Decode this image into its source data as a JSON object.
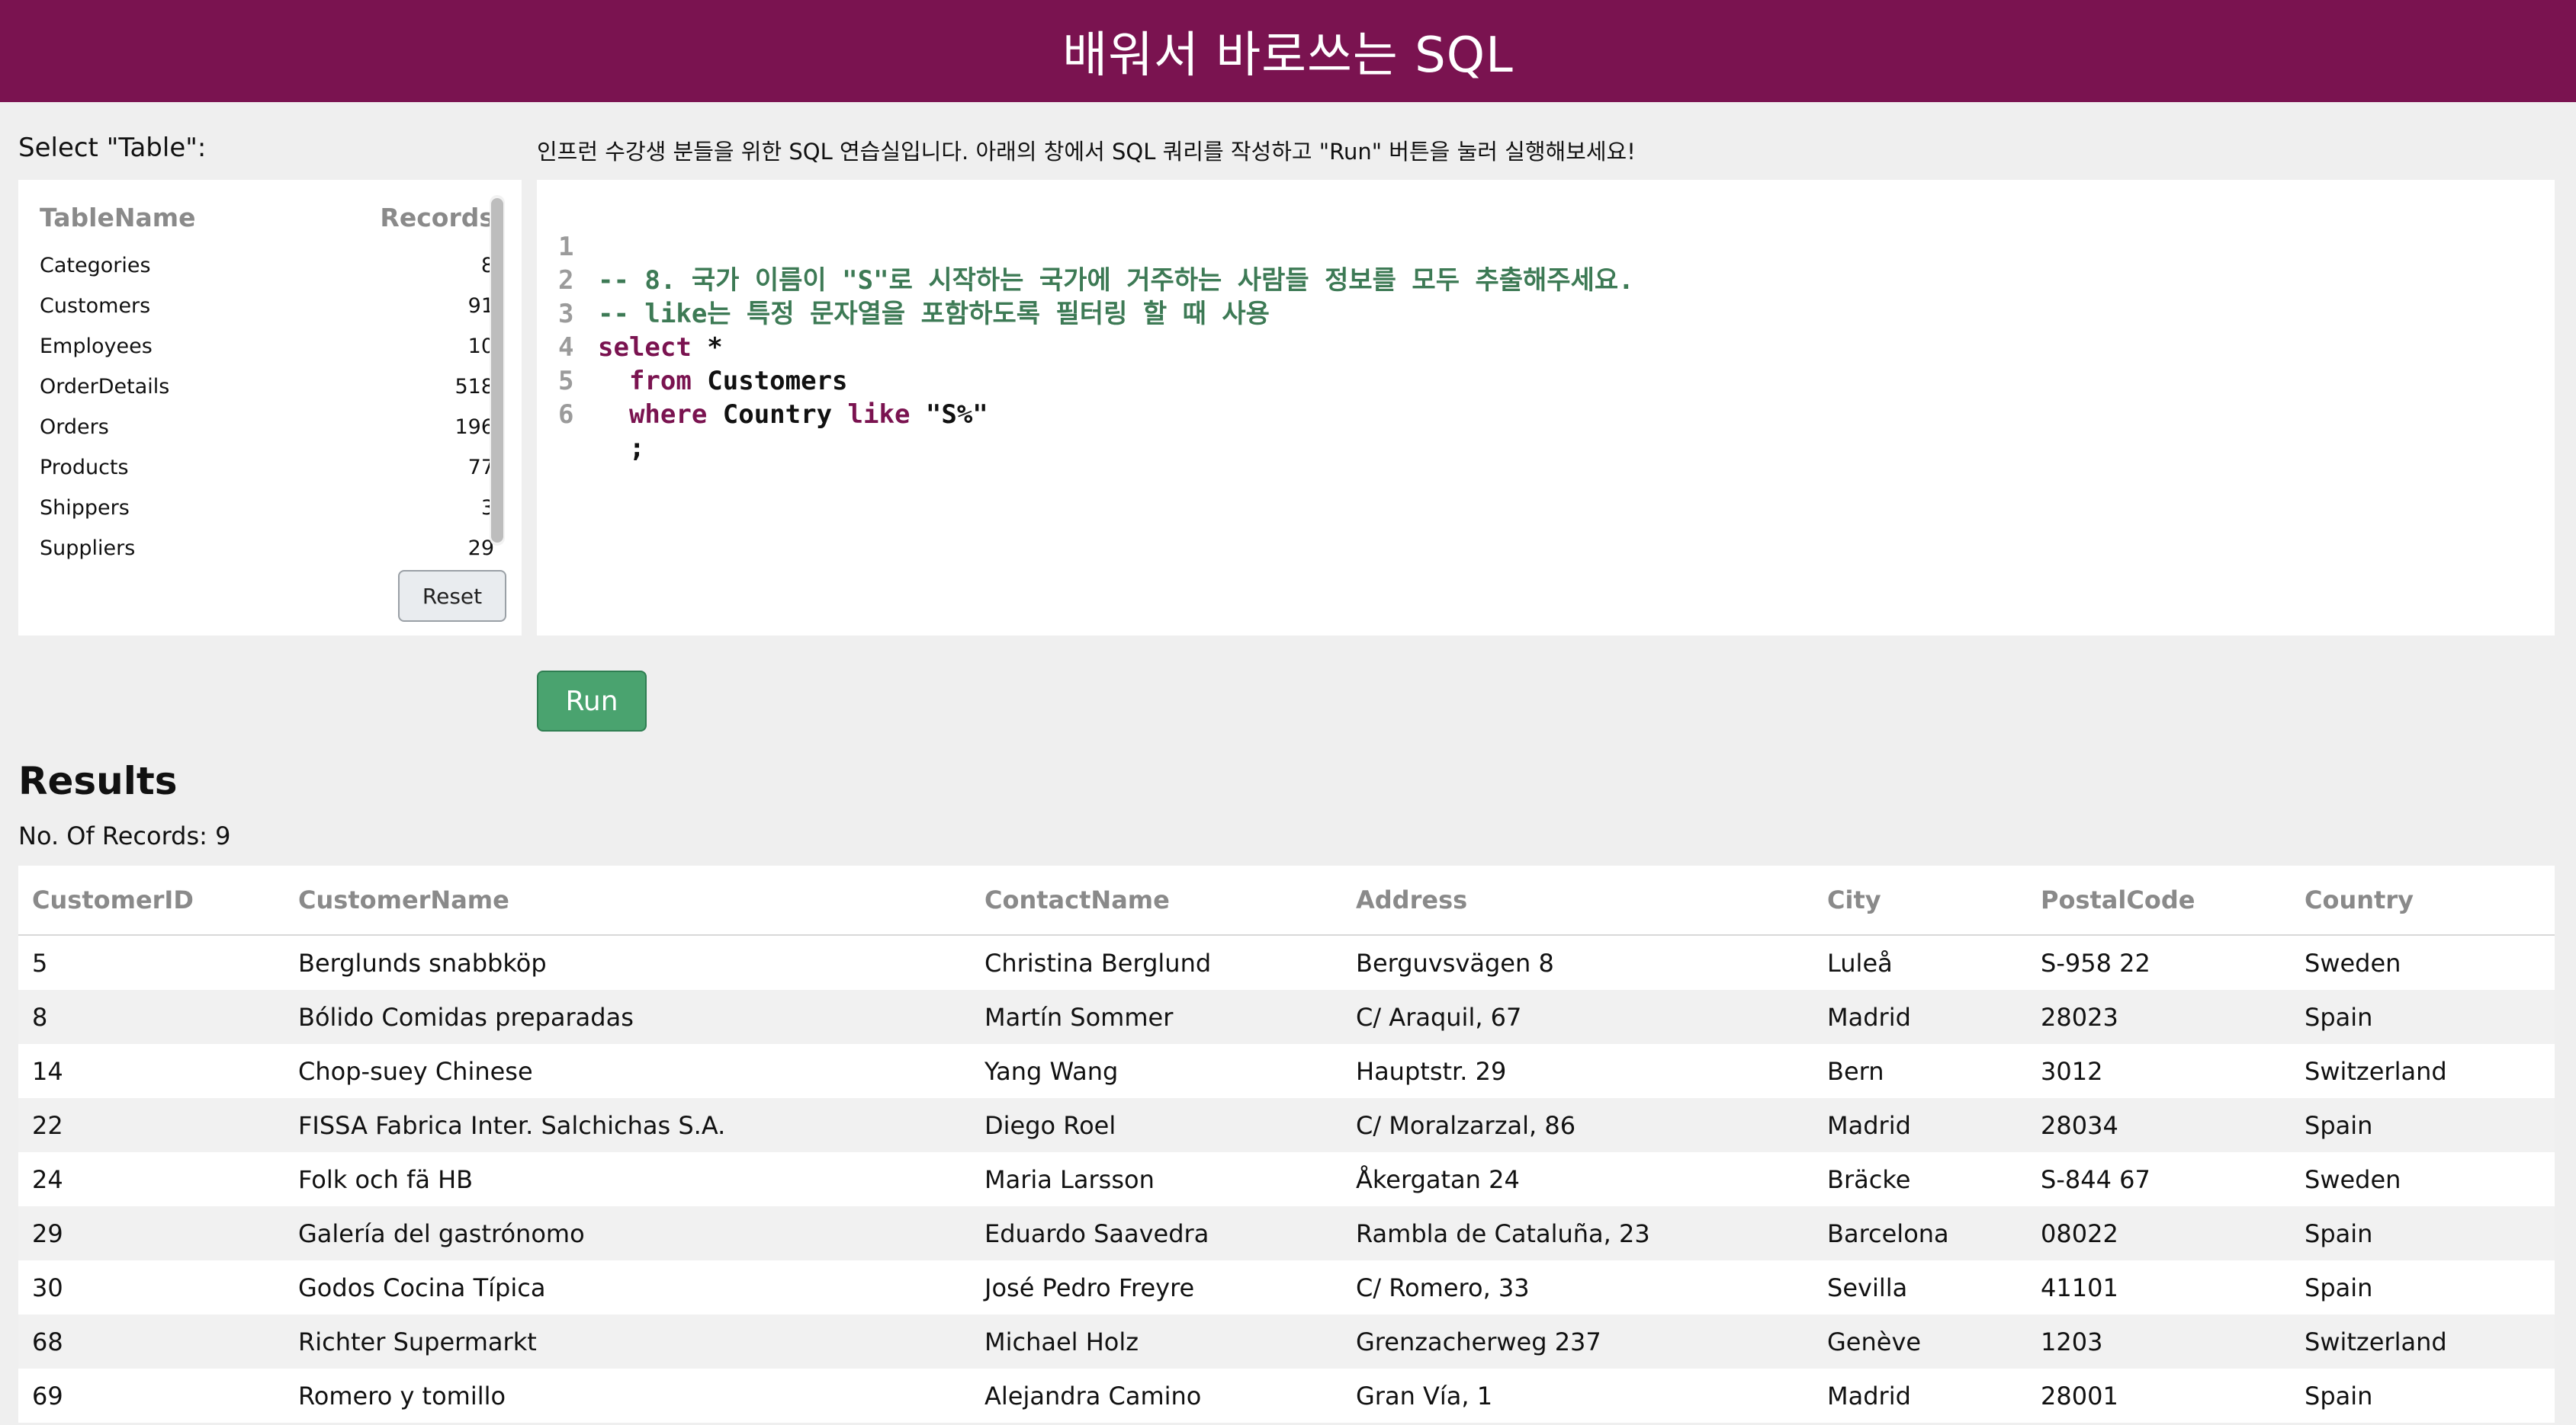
{
  "header": {
    "title": "배워서 바로쓰는 SQL"
  },
  "left": {
    "select_label": "Select \"Table\":",
    "col_name": "TableName",
    "col_records": "Records",
    "tables": [
      {
        "name": "Categories",
        "records": "8"
      },
      {
        "name": "Customers",
        "records": "91"
      },
      {
        "name": "Employees",
        "records": "10"
      },
      {
        "name": "OrderDetails",
        "records": "518"
      },
      {
        "name": "Orders",
        "records": "196"
      },
      {
        "name": "Products",
        "records": "77"
      },
      {
        "name": "Shippers",
        "records": "3"
      },
      {
        "name": "Suppliers",
        "records": "29"
      }
    ],
    "reset_label": "Reset"
  },
  "intro": "인프런 수강생 분들을 위한 SQL 연습실입니다. 아래의 창에서 SQL 쿼리를 작성하고 \"Run\" 버튼을 눌러 실행해보세요!",
  "editor": {
    "lines": [
      {
        "num": "1",
        "parts": [
          {
            "t": "-- 8. 국가 이름이 \"S\"로 시작하는 국가에 거주하는 사람들 정보를 모두 추출해주세요.",
            "c": "cm"
          }
        ]
      },
      {
        "num": "2",
        "parts": [
          {
            "t": "-- like는 특정 문자열을 포함하도록 필터링 할 때 사용",
            "c": "cm"
          }
        ]
      },
      {
        "num": "3",
        "parts": [
          {
            "t": "select",
            "c": "kw"
          },
          {
            "t": " *",
            "c": "id"
          }
        ]
      },
      {
        "num": "4",
        "parts": [
          {
            "t": "  from",
            "c": "kw"
          },
          {
            "t": " Customers",
            "c": "id"
          }
        ]
      },
      {
        "num": "5",
        "parts": [
          {
            "t": "  where",
            "c": "kw"
          },
          {
            "t": " Country ",
            "c": "id"
          },
          {
            "t": "like",
            "c": "kw"
          },
          {
            "t": " \"S%\"",
            "c": "id"
          }
        ]
      },
      {
        "num": "6",
        "parts": [
          {
            "t": "  ;",
            "c": "id"
          }
        ]
      }
    ]
  },
  "run_label": "Run",
  "results": {
    "title": "Results",
    "count_text": "No. Of Records: 9",
    "columns": [
      "CustomerID",
      "CustomerName",
      "ContactName",
      "Address",
      "City",
      "PostalCode",
      "Country"
    ],
    "rows": [
      [
        "5",
        "Berglunds snabbköp",
        "Christina Berglund",
        "Berguvsvägen 8",
        "Luleå",
        "S-958 22",
        "Sweden"
      ],
      [
        "8",
        "Bólido Comidas preparadas",
        "Martín Sommer",
        "C/ Araquil, 67",
        "Madrid",
        "28023",
        "Spain"
      ],
      [
        "14",
        "Chop-suey Chinese",
        "Yang Wang",
        "Hauptstr. 29",
        "Bern",
        "3012",
        "Switzerland"
      ],
      [
        "22",
        "FISSA Fabrica Inter. Salchichas S.A.",
        "Diego Roel",
        "C/ Moralzarzal, 86",
        "Madrid",
        "28034",
        "Spain"
      ],
      [
        "24",
        "Folk och fä HB",
        "Maria Larsson",
        "Åkergatan 24",
        "Bräcke",
        "S-844 67",
        "Sweden"
      ],
      [
        "29",
        "Galería del gastrónomo",
        "Eduardo Saavedra",
        "Rambla de Cataluña, 23",
        "Barcelona",
        "08022",
        "Spain"
      ],
      [
        "30",
        "Godos Cocina Típica",
        "José Pedro Freyre",
        "C/ Romero, 33",
        "Sevilla",
        "41101",
        "Spain"
      ],
      [
        "68",
        "Richter Supermarkt",
        "Michael Holz",
        "Grenzacherweg 237",
        "Genève",
        "1203",
        "Switzerland"
      ],
      [
        "69",
        "Romero y tomillo",
        "Alejandra Camino",
        "Gran Vía, 1",
        "Madrid",
        "28001",
        "Spain"
      ]
    ]
  },
  "colors": {
    "header_bg": "#7a1350",
    "keyword": "#7a1350",
    "comment": "#3d7a55",
    "run_button": "#4aa36f"
  }
}
